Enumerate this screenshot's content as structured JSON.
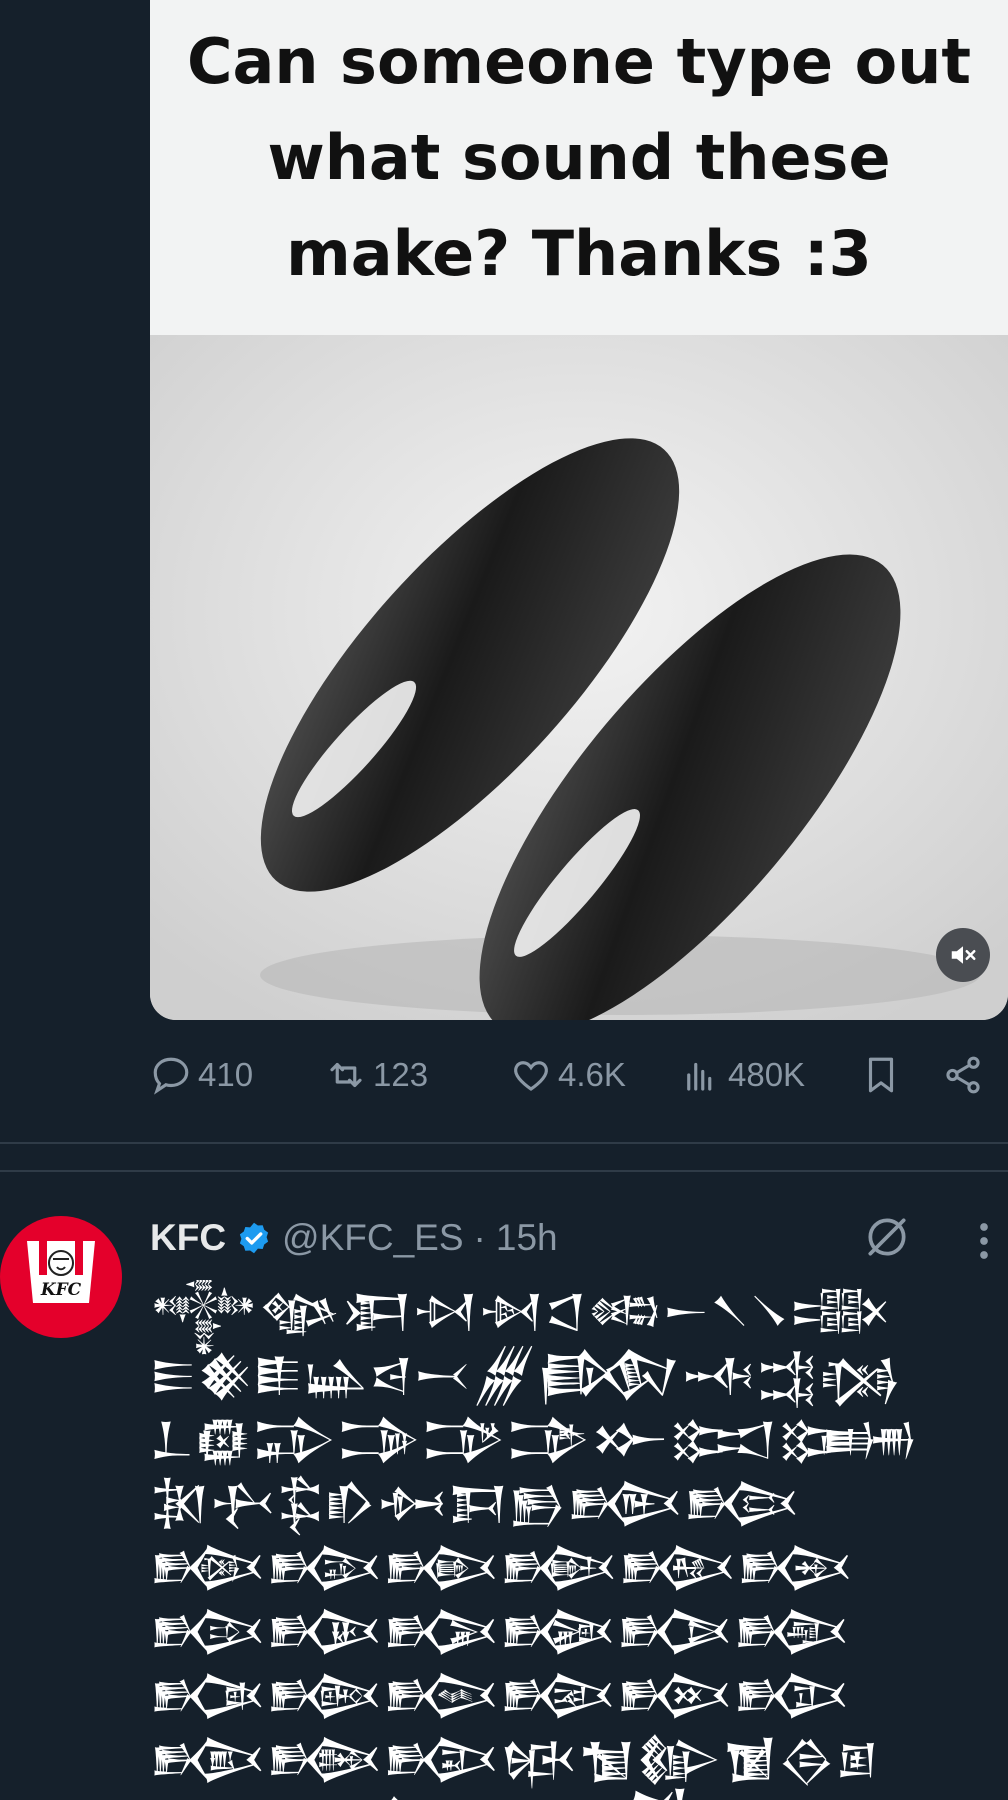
{
  "media": {
    "caption": "Can someone type out\nwhat sound these\nmake? Thanks :3",
    "icons": {
      "mute": "muted-speaker-icon"
    }
  },
  "actions": {
    "replies": "410",
    "reposts": "123",
    "likes": "4.6K",
    "views": "480K"
  },
  "reply": {
    "name": "KFC",
    "handle": "@KFC_ES",
    "separator": "·",
    "time": "15h",
    "avatar_text": "KFC",
    "verified_color": "#1d9bf0",
    "text": "𒀱𒀲𒀳𒀴𒀵𒀶𒀷𒀸𒀹𒀺𒀻𒀼𒀽𒀾𒀿𒁀𒁁𒁂𒁃𒁄𒁅𒁆𒁇𒁈𒁉𒁊𒁋𒁌𒁍𒁎𒁏𒁐𒁑𒁒𒁓𒁔𒁕𒁖𒁗𒁘𒁙𒁚𒁛𒁜𒁝𒁞𒁟𒁠𒁡𒁢𒁣𒁤𒁥𒁦𒁧𒁨𒁩𒁪𒁫𒁬𒁭𒁮𒁯𒁰𒁱𒁲𒁳𒁴𒁵𒁶𒁷𒁸𒁹𒁺𒁻𒁼𒁽𒁾𒁿𒂀𒂁𒂂𒂃𒂄𒂅𒂆𒂇𒂈𒂉𒂊𒂋𒂌𒂍𒂎𒂏𒂐𒂑𒂒𒂓𒂔𒂕𒂖𒂗𒂘𒂙𒂚𒂛𒂜𒂝𒂞𒂟𒂠𒂡𒂢𒂣𒂤𒂥𒂦𒂧𒂨𒂩𒂪𒂫𒂬𒂭𒂮𒂯𒂰𒂱𒂲𒂳𒂴𒂵𒂶𒂷𒂸𒂹𒂺"
  }
}
